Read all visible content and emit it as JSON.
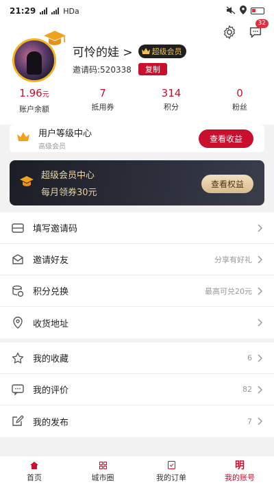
{
  "status_bar": {
    "time": "21:29",
    "network": "HDa"
  },
  "header": {
    "message_badge": "32",
    "username": "可怜的娃 >",
    "vip_badge": "超级会员",
    "invite_label": "邀请码:520338",
    "copy_button": "复制"
  },
  "stats": [
    {
      "value": "1.96",
      "unit": "元",
      "label": "账户余额"
    },
    {
      "value": "7",
      "unit": "",
      "label": "抵用券"
    },
    {
      "value": "314",
      "unit": "",
      "label": "积分"
    },
    {
      "value": "0",
      "unit": "",
      "label": "粉丝"
    }
  ],
  "level_card": {
    "title": "用户等级中心",
    "subtitle": "高级会员",
    "button": "查看收益"
  },
  "vip_card": {
    "title": "超级会员中心",
    "subtitle": "每月领券30元",
    "button": "查看权益"
  },
  "menu1": [
    {
      "icon": "invite-code-icon",
      "label": "填写邀请码",
      "right": ""
    },
    {
      "icon": "invite-friend-icon",
      "label": "邀请好友",
      "right": "分享有好礼"
    },
    {
      "icon": "points-exchange-icon",
      "label": "积分兑换",
      "right": "最高可兑20元"
    },
    {
      "icon": "address-icon",
      "label": "收货地址",
      "right": ""
    }
  ],
  "menu2": [
    {
      "icon": "star-icon",
      "label": "我的收藏",
      "right": "6"
    },
    {
      "icon": "comment-icon",
      "label": "我的评价",
      "right": "82"
    },
    {
      "icon": "edit-icon",
      "label": "我的发布",
      "right": "7"
    }
  ],
  "tabs": [
    {
      "label": "首页",
      "icon": "home-icon",
      "active": false
    },
    {
      "label": "城市圈",
      "icon": "grid-icon",
      "active": false
    },
    {
      "label": "我的订单",
      "icon": "order-icon",
      "active": false
    },
    {
      "label": "我的账号",
      "icon": "account-icon",
      "active": true
    }
  ],
  "colors": {
    "accent": "#c8102e",
    "gold": "#f2b31d",
    "vip_dark": "#1c1e26"
  }
}
